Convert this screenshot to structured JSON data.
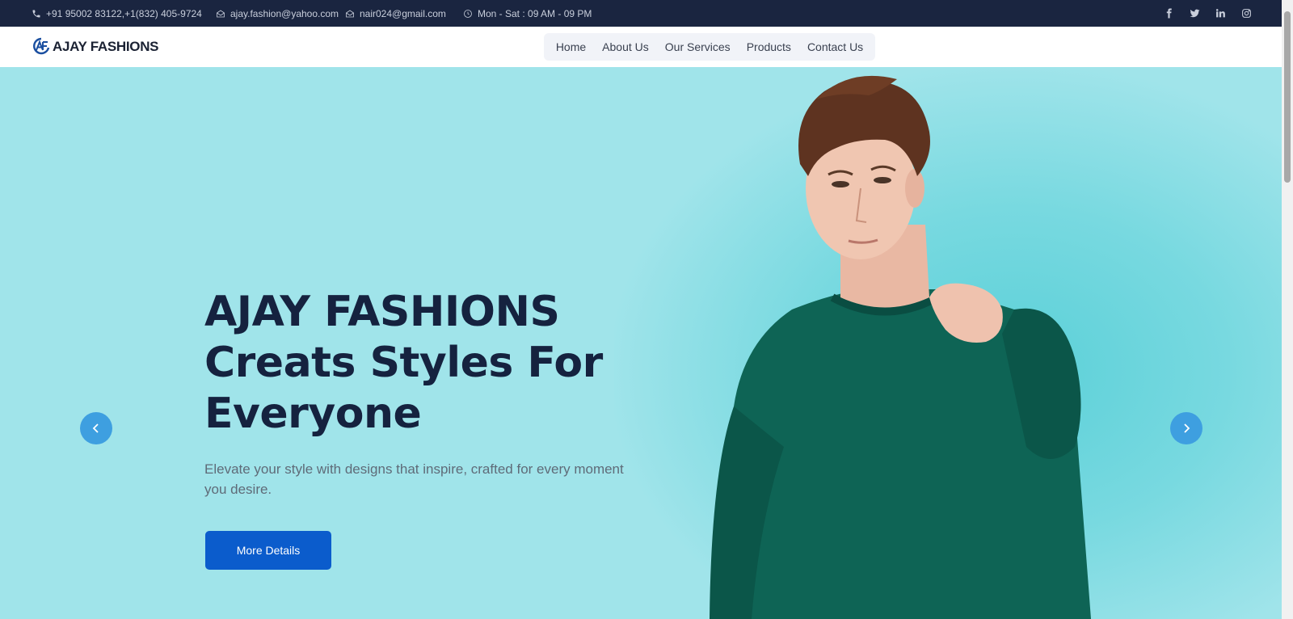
{
  "topbar": {
    "phone": "+91 95002 83122,+1(832) 405-9724",
    "email_1": "ajay.fashion@yahoo.com",
    "email_2": "nair024@gmail.com",
    "hours": "Mon - Sat : 09 AM - 09 PM",
    "social_icons": [
      "facebook-icon",
      "twitter-icon",
      "linkedin-icon",
      "instagram-icon"
    ]
  },
  "header": {
    "logo_text": "AJAY FASHIONS",
    "nav": [
      "Home",
      "About Us",
      "Our Services",
      "Products",
      "Contact Us"
    ]
  },
  "hero": {
    "title_line_1": "AJAY FASHIONS",
    "title_line_2": "Creats Styles For",
    "title_line_3": "Everyone",
    "subtitle": "Elevate your style with designs that inspire, crafted for every moment you desire.",
    "button_label": "More Details"
  },
  "colors": {
    "topbar_bg": "#1a2540",
    "hero_bg": "#a0e4ea",
    "title": "#15223f",
    "button": "#0b5ccc",
    "arrow": "#3e9fe0",
    "sweater": "#0e6455"
  }
}
